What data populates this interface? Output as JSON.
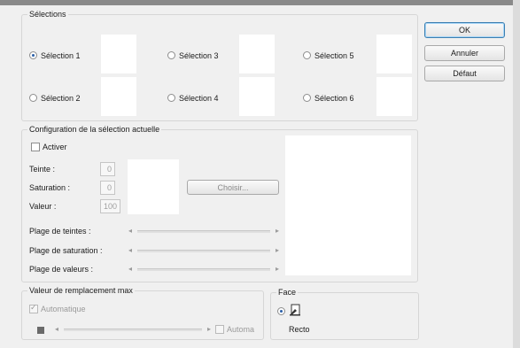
{
  "selections_group": {
    "title": "Sélections",
    "items": [
      {
        "label": "Sélection 1",
        "checked": true
      },
      {
        "label": "Sélection 2",
        "checked": false
      },
      {
        "label": "Sélection 3",
        "checked": false
      },
      {
        "label": "Sélection 4",
        "checked": false
      },
      {
        "label": "Sélection 5",
        "checked": false
      },
      {
        "label": "Sélection 6",
        "checked": false
      }
    ]
  },
  "buttons": {
    "ok": "OK",
    "cancel": "Annuler",
    "default": "Défaut",
    "choose": "Choisir..."
  },
  "config_group": {
    "title": "Configuration de la sélection actuelle",
    "activate_label": "Activer",
    "activate_checked": false,
    "hue_label": "Teinte :",
    "hue_value": "0",
    "saturation_label": "Saturation :",
    "saturation_value": "0",
    "value_label": "Valeur :",
    "value_value": "100",
    "hue_range_label": "Plage de teintes :",
    "saturation_range_label": "Plage de saturation :",
    "value_range_label": "Plage de valeurs :"
  },
  "replacement_group": {
    "title": "Valeur de remplacement max",
    "auto_label": "Automatique",
    "auto_checked": true,
    "auto2_label": "Automa"
  },
  "face_group": {
    "title": "Face",
    "recto_label": "Recto",
    "recto_checked": true
  },
  "icons": {
    "scroll_left": "◂",
    "scroll_right": "▸"
  }
}
